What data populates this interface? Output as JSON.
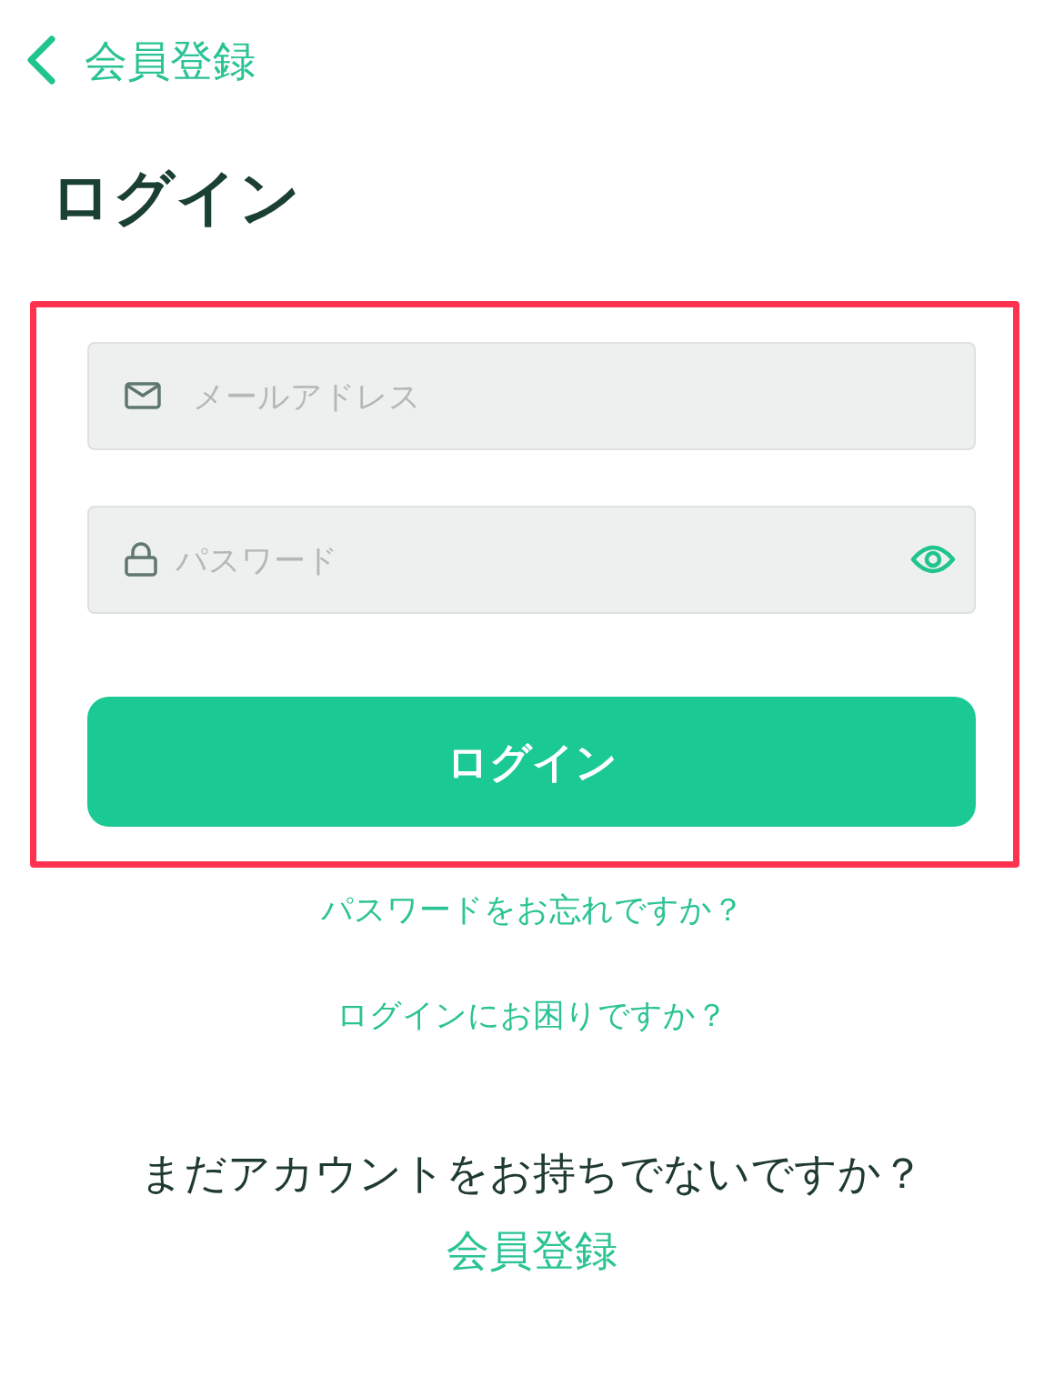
{
  "header": {
    "back_label": "会員登録"
  },
  "title": "ログイン",
  "form": {
    "email_field": {
      "placeholder": "メールアドレス"
    },
    "password_field": {
      "placeholder": "パスワード"
    },
    "submit_button": "ログイン"
  },
  "links": [
    "パスワードをお忘れですか？",
    "ログインにお困りですか？"
  ],
  "signup": {
    "prompt": "まだアカウントをお持ちでないですか？",
    "link": "会員登録"
  }
}
